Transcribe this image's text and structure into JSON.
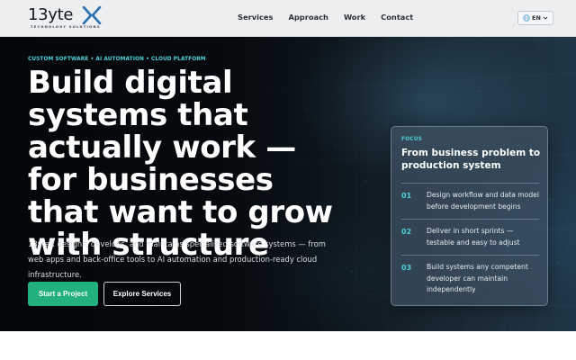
{
  "brand": {
    "logo_text": "13yte",
    "logo_tagline": "TECHNOLOGY SOLUTIONS",
    "logo_mark_icon": "x-logo-mark",
    "accent_color": "#2b6fb3"
  },
  "nav": {
    "items": [
      "Services",
      "Approach",
      "Work",
      "Contact"
    ]
  },
  "language": {
    "code": "EN",
    "icon": "globe-icon",
    "chevron_icon": "chevron-down-icon"
  },
  "hero": {
    "eyebrow": "CUSTOM SOFTWARE • AI AUTOMATION • CLOUD PLATFORM",
    "headline": "Build digital systems that actually work — for businesses that want to grow with structure",
    "lead": "13yteX designs, develops, and maintains specialized software systems — from web apps and back-office tools to AI automation and production-ready cloud infrastructure.",
    "primary_cta": "Start a Project",
    "secondary_cta": "Explore Services",
    "colors": {
      "eyebrow": "#4fd0d9",
      "primary_button": "#22b07d"
    }
  },
  "focus_card": {
    "kicker": "FOCUS",
    "title": "From business problem to production system",
    "items": [
      {
        "num": "01",
        "text": "Design workflow and data model before development begins"
      },
      {
        "num": "02",
        "text": "Deliver in short sprints — testable and easy to adjust"
      },
      {
        "num": "03",
        "text": "Build systems any competent developer can maintain independently"
      }
    ]
  }
}
